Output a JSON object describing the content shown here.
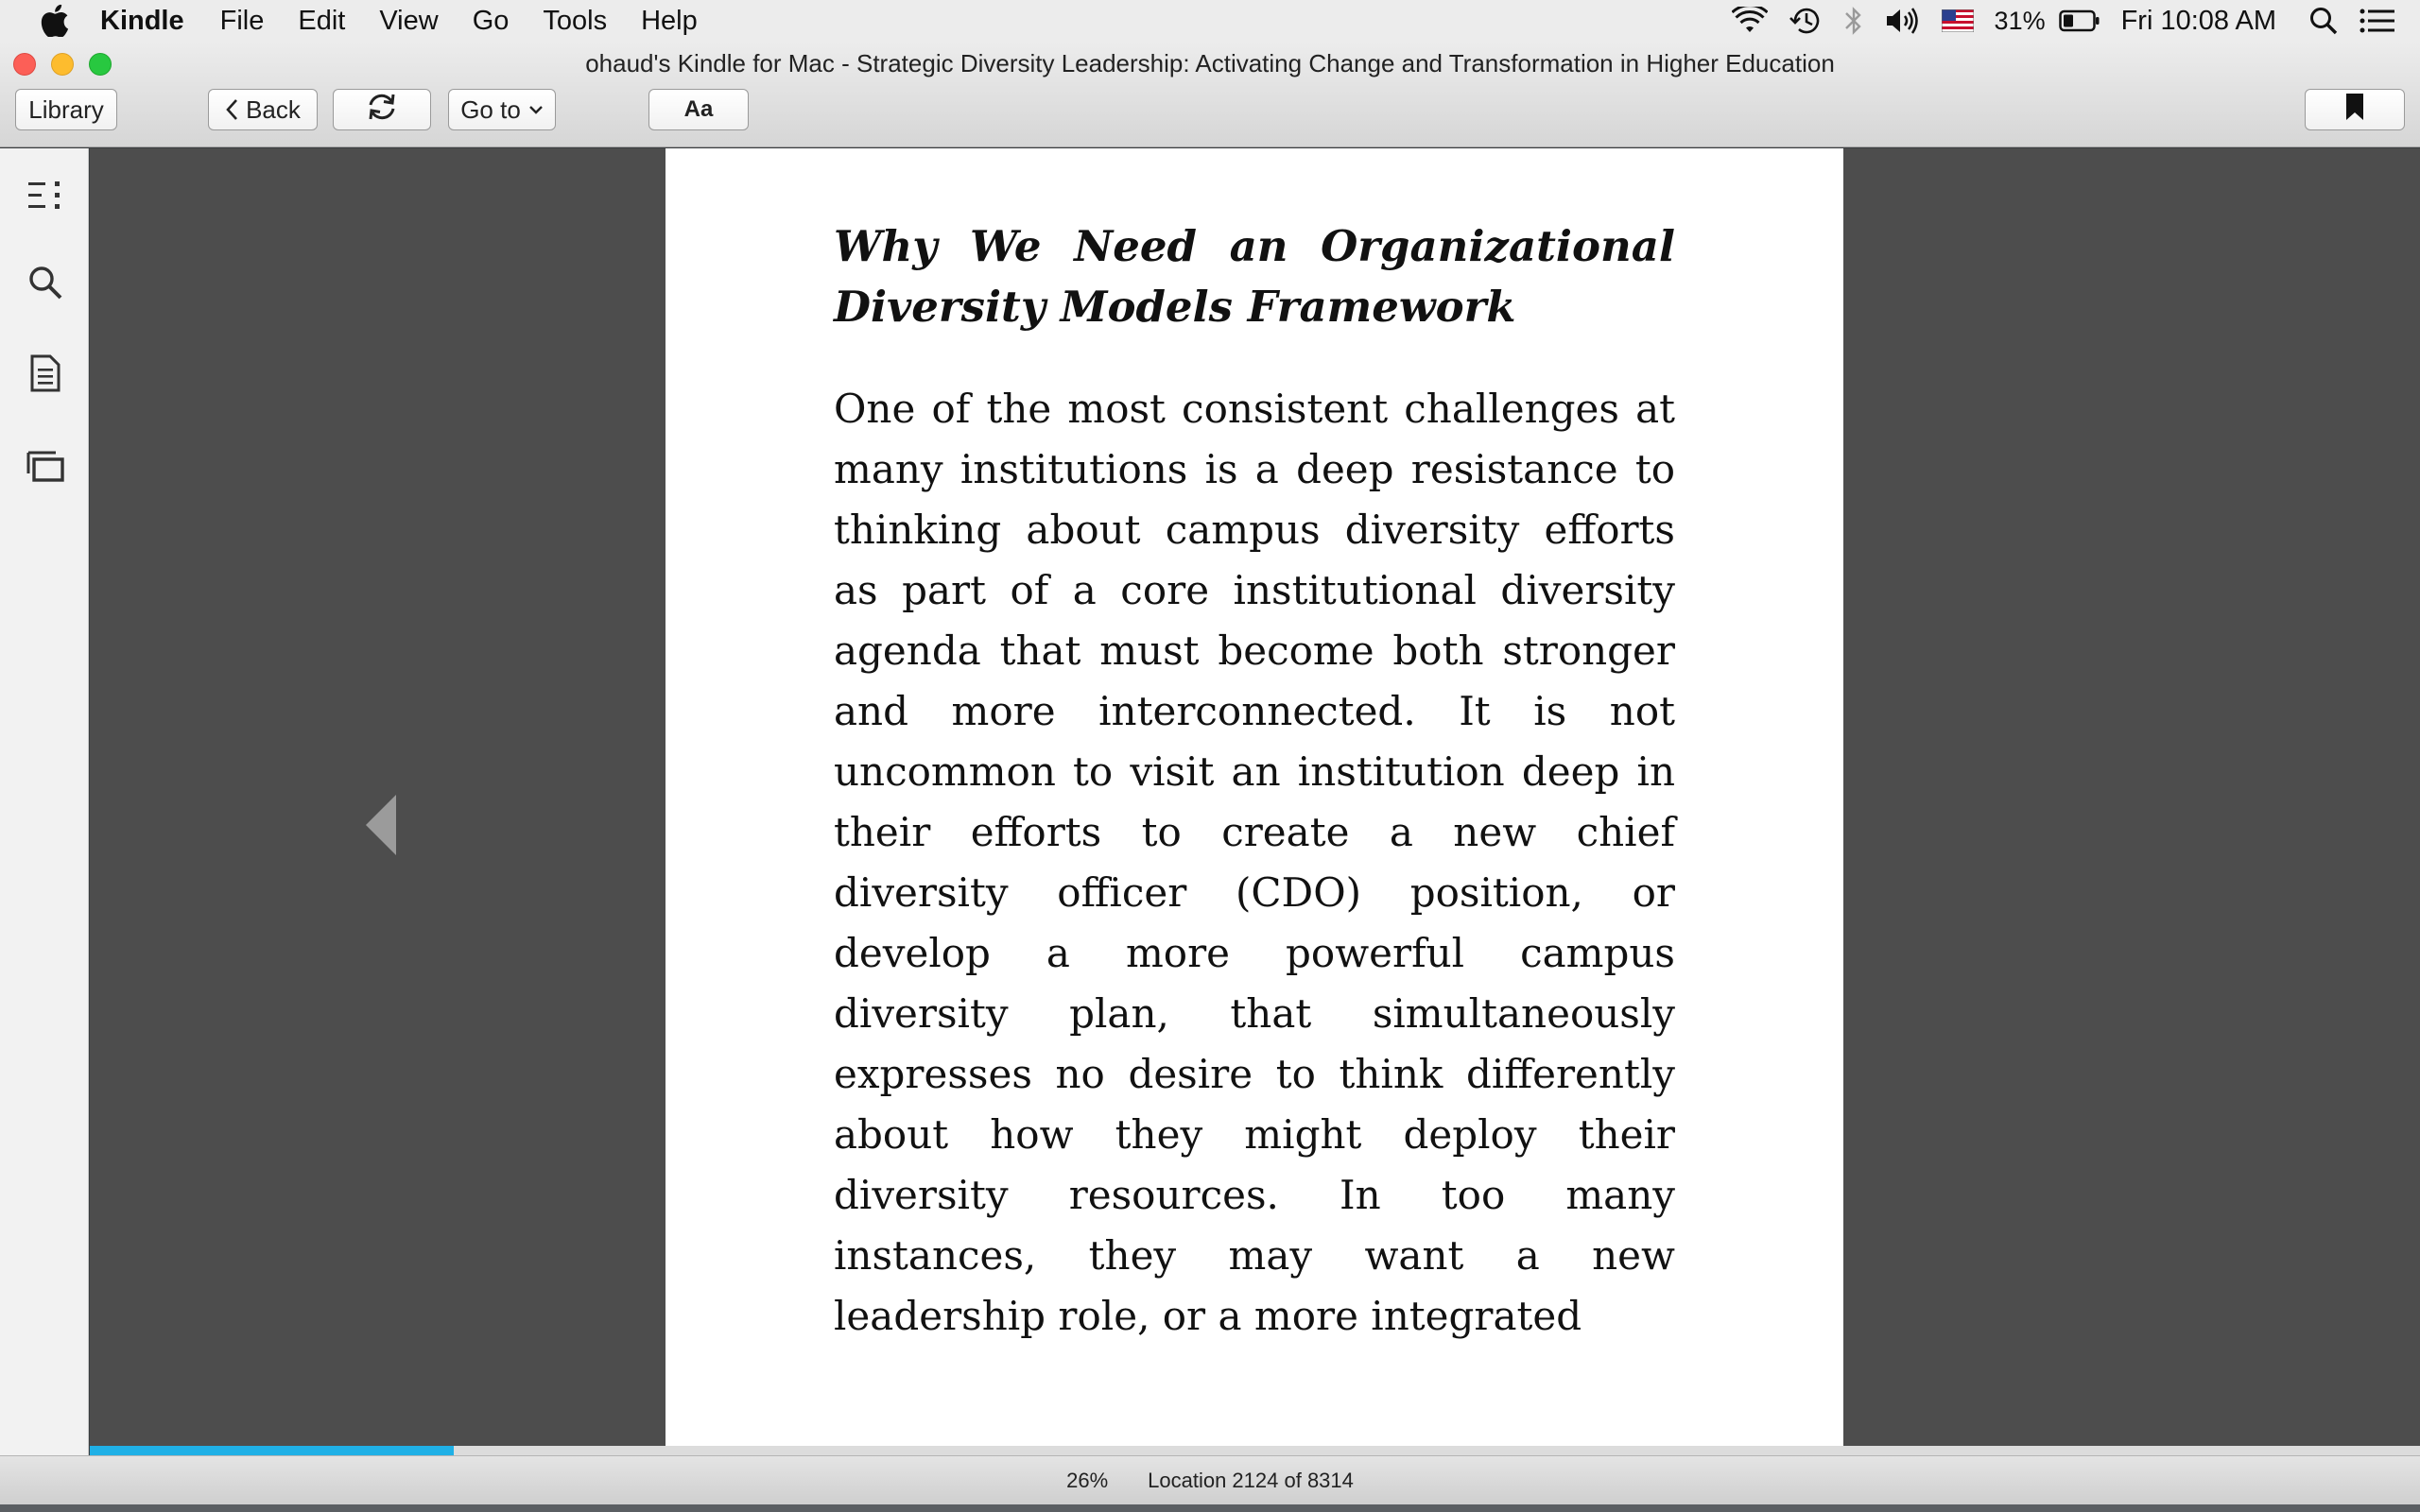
{
  "menubar": {
    "app_name": "Kindle",
    "items": [
      "File",
      "Edit",
      "View",
      "Go",
      "Tools",
      "Help"
    ],
    "battery_percent": "31%",
    "clock": "Fri 10:08 AM"
  },
  "window": {
    "title": "ohaud's Kindle for Mac - Strategic Diversity Leadership: Activating Change and Transformation in Higher Education"
  },
  "toolbar": {
    "library_label": "Library",
    "back_label": "Back",
    "goto_label": "Go to",
    "font_label": "Aa"
  },
  "sidebar": {
    "icons": [
      "table-of-contents-icon",
      "search-icon",
      "notes-icon",
      "flashcards-icon"
    ]
  },
  "book": {
    "heading": "Why We Need an Organizational Diversity Models Framework",
    "body": "One of the most consistent challenges at many institutions is a deep resistance to thinking about campus diversity efforts as part of a core institutional diversity agenda that must become both stronger and more interconnected. It is not uncommon to visit an institution deep in their efforts to create a new chief diversity officer (CDO) position, or develop a more powerful campus diversity plan, that simultaneously expresses no desire to think differently about how they might deploy their diversity resources. In too many instances, they may want a new leadership role, or a more integrated"
  },
  "status": {
    "percent_label": "26%",
    "progress_fraction": 0.156,
    "location_label": "Location 2124 of 8314"
  },
  "colors": {
    "progress": "#1fb0e6",
    "reader_bg": "#4d4d4d",
    "page_bg": "#ffffff"
  }
}
